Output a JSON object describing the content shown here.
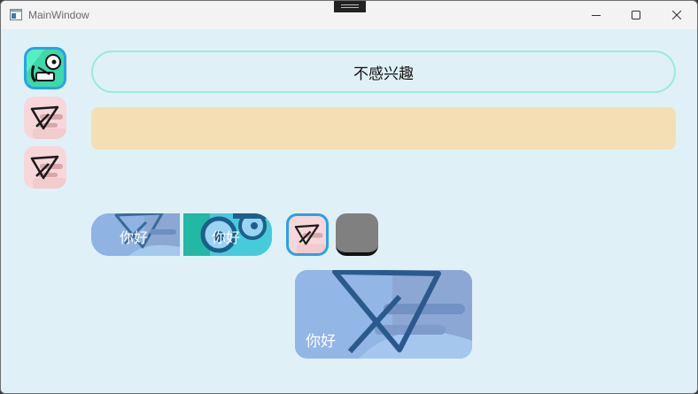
{
  "window": {
    "title": "MainWindow"
  },
  "titlebar": {
    "minimize_icon": "minimize-icon",
    "maximize_icon": "maximize-icon",
    "close_icon": "close-icon"
  },
  "sidebar": {
    "items": [
      {
        "icon": "mascot-icon"
      },
      {
        "icon": "paper-plane-icon"
      },
      {
        "icon": "paper-plane-icon"
      }
    ]
  },
  "main": {
    "pill_button": {
      "label": "不感兴趣",
      "border_color": "#9fe8dc"
    },
    "banner_color": "#f4dfb5",
    "tiles": [
      {
        "label": "你好",
        "icon": "paper-plane-icon"
      },
      {
        "label": "你好",
        "icon": "mascot-icon"
      },
      {
        "label": "你好",
        "icon": "paper-plane-icon"
      }
    ],
    "small_buttons": [
      {
        "icon": "paper-plane-icon",
        "border_color": "#3aa0e8"
      },
      {
        "color": "#808080"
      }
    ]
  }
}
